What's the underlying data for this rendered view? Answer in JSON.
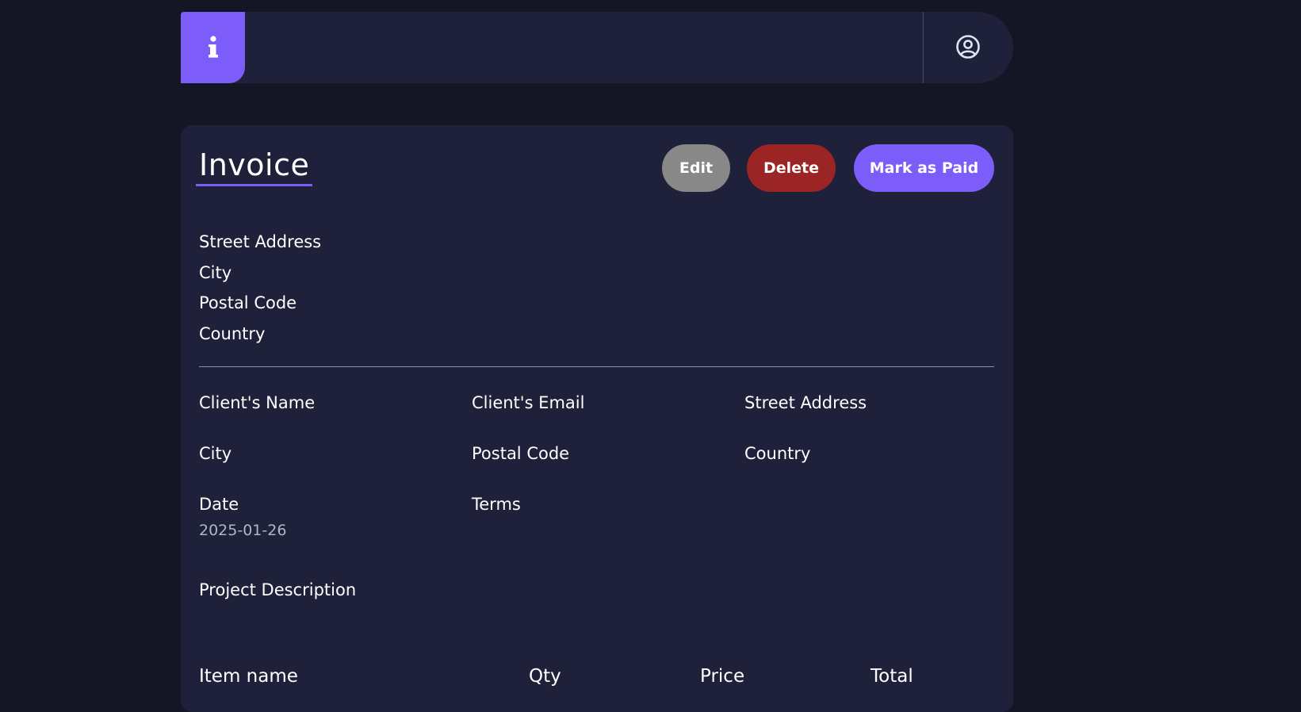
{
  "colors": {
    "background": "#141625",
    "surface": "#1e2139",
    "accent": "#7c5dfa",
    "danger": "#9b2525",
    "neutral": "#888888",
    "muted_text": "#b2b5c9"
  },
  "header": {
    "logo_icon": "info-icon",
    "avatar_icon": "user-circle-icon"
  },
  "invoice": {
    "title": "Invoice",
    "actions": {
      "edit_label": "Edit",
      "delete_label": "Delete",
      "mark_paid_label": "Mark as Paid"
    },
    "sender": {
      "street": "Street Address",
      "city": "City",
      "postal": "Postal Code",
      "country": "Country"
    },
    "client": {
      "name_label": "Client's Name",
      "email_label": "Client's Email",
      "street_label": "Street Address",
      "city_label": "City",
      "postal_label": "Postal Code",
      "country_label": "Country"
    },
    "date_label": "Date",
    "date_value": "2025-01-26",
    "terms_label": "Terms",
    "description_label": "Project Description",
    "items_header": {
      "name": "Item name",
      "qty": "Qty",
      "price": "Price",
      "total": "Total"
    }
  }
}
